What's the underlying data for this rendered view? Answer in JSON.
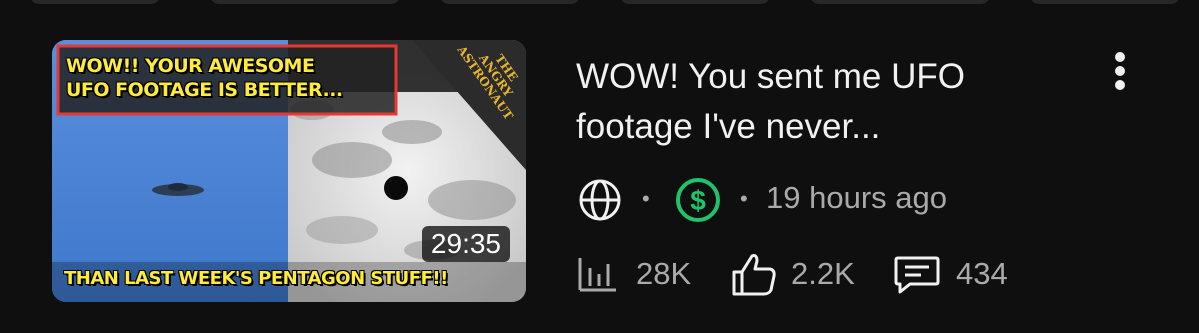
{
  "video": {
    "title": "WOW!  You sent me UFO footage I've never...",
    "duration": "29:35",
    "published": "19 hours ago",
    "stats": {
      "views": "28K",
      "likes": "2.2K",
      "comments": "434"
    },
    "thumbnail": {
      "caption_top_line1": "WOW!! YOUR AWESOME",
      "caption_top_line2": "UFO FOOTAGE IS BETTER...",
      "caption_bottom": "THAN LAST WEEK'S PENTAGON STUFF!!",
      "brand_line1": "THE",
      "brand_line2": "ANGRY",
      "brand_line3": "ASTRONAUT"
    }
  },
  "icons": {
    "visibility": "globe-icon",
    "monetization": "dollar-circle-icon",
    "views": "bar-chart-icon",
    "likes": "thumbs-up-icon",
    "comments": "comment-icon",
    "menu": "more-vertical-icon"
  },
  "colors": {
    "background": "#0f0f0f",
    "primary_text": "#f1f1f1",
    "secondary_text": "#aaaaaa",
    "monetized_green": "#1ec46b",
    "caption_yellow": "#ffeb3b"
  }
}
